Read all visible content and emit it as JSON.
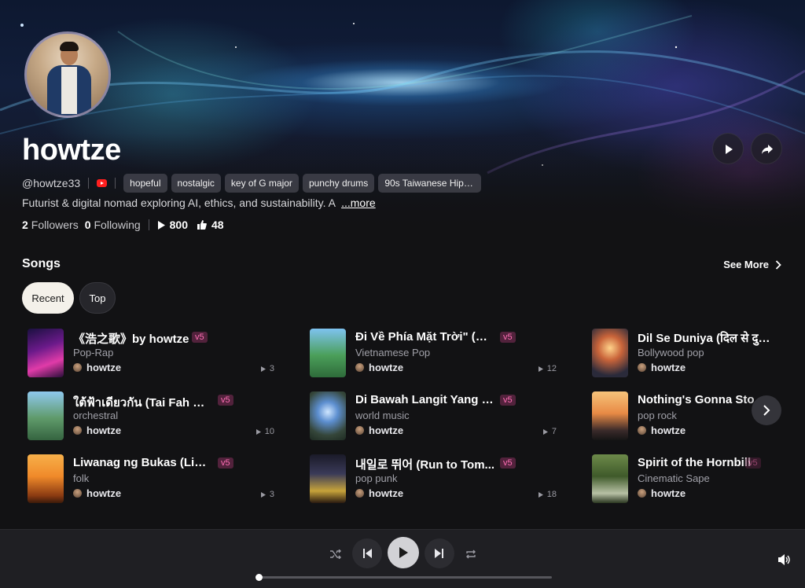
{
  "profile": {
    "name": "howtze",
    "handle": "@howtze33",
    "tags": [
      "hopeful",
      "nostalgic",
      "key of G major",
      "punchy drums",
      "90s Taiwanese Hip-ho..."
    ],
    "bio": "Futurist & digital nomad exploring AI, ethics, and sustainability. A",
    "bio_more": "...more",
    "followers_count": "2",
    "followers_label": "Followers",
    "following_count": "0",
    "following_label": "Following",
    "plays": "800",
    "likes": "48",
    "social_icon": "youtube-icon"
  },
  "songs_section": {
    "title": "Songs",
    "see_more": "See More",
    "tabs": [
      "Recent",
      "Top"
    ],
    "active_tab": "Recent"
  },
  "songs": [
    {
      "title": "《浩之歌》by howtze",
      "version": "v5",
      "genre": "Pop-Rap",
      "author": "howtze",
      "plays": "3"
    },
    {
      "title": "Đi Về Phía Mặt Trời\" (Wal...",
      "version": "v5",
      "genre": "Vietnamese Pop",
      "author": "howtze",
      "plays": "12"
    },
    {
      "title": "Dil Se Duniya (दिल से दुनि...",
      "version": "v5",
      "genre": "Bollywood pop",
      "author": "howtze",
      "plays": ""
    },
    {
      "title": "ใต้ฟ้าเดียวกัน (Tai Fah Dia...",
      "version": "v5",
      "genre": "orchestral",
      "author": "howtze",
      "plays": "10"
    },
    {
      "title": "Di Bawah Langit Yang Sa...",
      "version": "v5",
      "genre": "world music",
      "author": "howtze",
      "plays": "7"
    },
    {
      "title": "Nothing's Gonna Stop T...",
      "version": "v5",
      "genre": "pop rock",
      "author": "howtze",
      "plays": ""
    },
    {
      "title": "Liwanag ng Bukas (Light ...",
      "version": "v5",
      "genre": "folk",
      "author": "howtze",
      "plays": "3"
    },
    {
      "title": "내일로 뛰어 (Run to Tom...",
      "version": "v5",
      "genre": "pop punk",
      "author": "howtze",
      "plays": "18"
    },
    {
      "title": "Spirit of the Hornbill",
      "version": "v5",
      "genre": "Cinematic Sape",
      "author": "howtze",
      "plays": ""
    }
  ],
  "player": {
    "progress": 0.0,
    "controls": [
      "shuffle-icon",
      "previous-icon",
      "play-icon",
      "next-icon",
      "repeat-icon",
      "volume-icon"
    ]
  },
  "colors": {
    "background": "#121214",
    "accent_badge": "#ff6fb5",
    "pill_active": "#f4f1ea",
    "player_bar": "#1f1f23"
  }
}
